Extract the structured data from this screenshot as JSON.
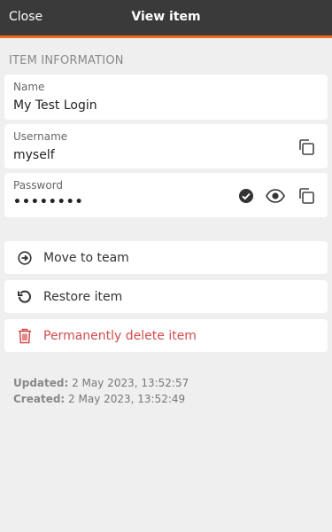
{
  "header": {
    "close_label": "Close",
    "title": "View item"
  },
  "section": {
    "label": "ITEM INFORMATION"
  },
  "fields": {
    "name": {
      "label": "Name",
      "value": "My Test Login"
    },
    "username": {
      "label": "Username",
      "value": "myself"
    },
    "password": {
      "label": "Password",
      "value": "••••••••"
    }
  },
  "actions": {
    "move": "Move to team",
    "restore": "Restore item",
    "delete": "Permanently delete item"
  },
  "meta": {
    "updated_label": "Updated:",
    "updated_value": " 2 May 2023, 13:52:57",
    "created_label": "Created:",
    "created_value": " 2 May 2023, 13:52:49"
  },
  "colors": {
    "accent": "#f06b1f",
    "header_bg": "#3a3a3a",
    "danger": "#d04b4b"
  }
}
